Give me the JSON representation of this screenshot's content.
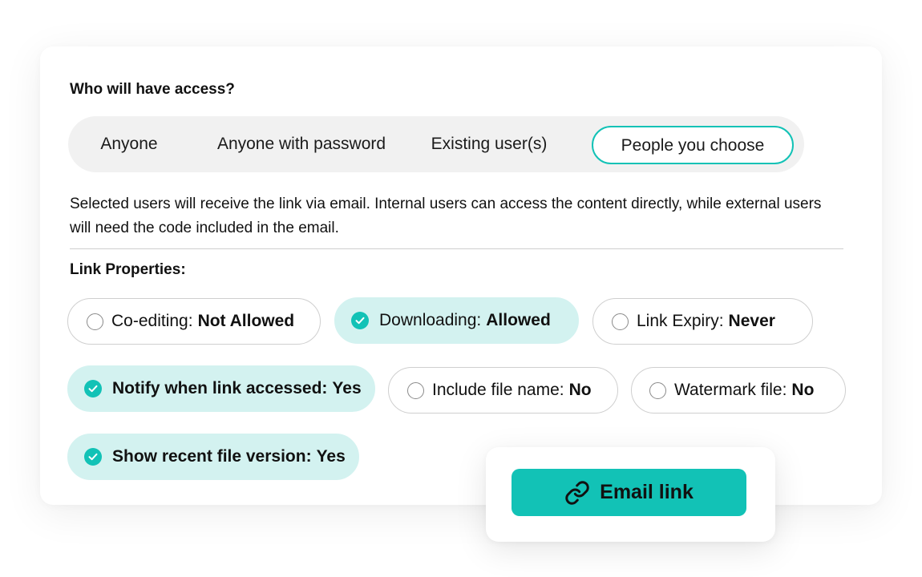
{
  "access": {
    "heading": "Who will have access?",
    "options": [
      {
        "label": "Anyone",
        "selected": false
      },
      {
        "label": "Anyone with password",
        "selected": false
      },
      {
        "label": "Existing user(s)",
        "selected": false
      },
      {
        "label": "People you choose",
        "selected": true
      }
    ],
    "description": "Selected users will receive the link via email. Internal users can access the content directly, while external users will need the code included in the email."
  },
  "properties": {
    "heading": "Link Properties:",
    "items": [
      {
        "label": "Co-editing:",
        "value": "Not Allowed",
        "checked": false
      },
      {
        "label": "Downloading:",
        "value": "Allowed",
        "checked": true
      },
      {
        "label": "Link Expiry:",
        "value": "Never",
        "checked": false
      },
      {
        "label": "Notify when link accessed:",
        "value": "Yes",
        "checked": true
      },
      {
        "label": "Include file name:",
        "value": "No",
        "checked": false
      },
      {
        "label": "Watermark file:",
        "value": "No",
        "checked": false
      },
      {
        "label": "Show recent file version:",
        "value": "Yes",
        "checked": true
      }
    ]
  },
  "action": {
    "label": "Email link",
    "icon": "link-icon"
  },
  "colors": {
    "accent": "#12c2b6",
    "accent_light": "#d3f2f0",
    "segment_bg": "#f1f1f1"
  }
}
